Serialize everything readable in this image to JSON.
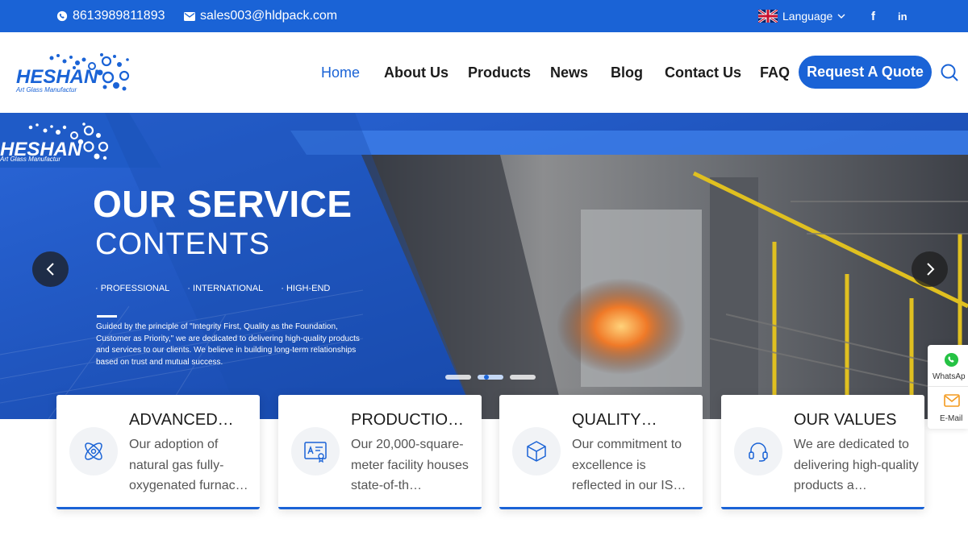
{
  "topbar": {
    "phone": "8613989811893",
    "email": "sales003@hldpack.com",
    "language": "Language",
    "facebook": "f",
    "linkedin": "in"
  },
  "header": {
    "logo_text": "HESHAN",
    "logo_sub": "Art Glass Manufactur",
    "nav": [
      "Home",
      "About Us",
      "Products",
      "News",
      "Blog",
      "Contact Us",
      "FAQ"
    ],
    "active_nav": "Home",
    "quote_button": "Request A Quote"
  },
  "hero": {
    "logo_text": "HESHAN",
    "logo_sub": "Art Glass Manufactur",
    "title1": "OUR SERVICE",
    "title2": "CONTENTS",
    "tags": [
      "· PROFESSIONAL",
      "· INTERNATIONAL",
      "· HIGH-END"
    ],
    "description": "Guided by the principle of \"Integrity First, Quality as the Foundation, Customer as Priority,\" we are dedicated to delivering high-quality products and services to our clients. We believe in building long-term relationships based on trust and mutual success.",
    "slides_total": 3,
    "slide_active": 2
  },
  "cards": [
    {
      "icon": "atom-icon",
      "title": "ADVANCED…",
      "text": "Our adoption of natural gas fully-oxygenated furnac…"
    },
    {
      "icon": "certificate-icon",
      "title": "PRODUCTION…",
      "text": "Our 20,000-square-meter facility houses state-of-th…"
    },
    {
      "icon": "box-icon",
      "title": "QUALITY…",
      "text": "Our commitment to excellence is reflected in our IS…"
    },
    {
      "icon": "headset-icon",
      "title": "OUR VALUES",
      "text": "We are dedicated to delivering high-quality products a…"
    }
  ],
  "side_contact": {
    "whatsapp": "WhatsAp",
    "email": "E-Mail"
  },
  "colors": {
    "brand_blue": "#1a63d6",
    "dark_blue": "#1c55c4"
  }
}
